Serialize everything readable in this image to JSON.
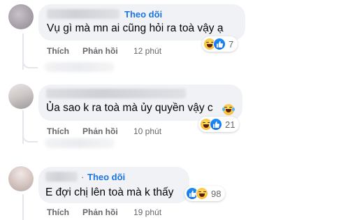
{
  "comments": [
    {
      "follow_label": "Theo dõi",
      "text": "Vụ gì mà mn ai cũng hỏi ra toà vậy ạ",
      "like_label": "Thích",
      "reply_label": "Phản hồi",
      "time": "12 phút",
      "reaction_count": "7",
      "reaction_icons": [
        "haha-icon",
        "like-icon"
      ]
    },
    {
      "follow_label": "",
      "text": "Ủa sao k ra toà mà ủy quyền vậy c",
      "like_label": "Thích",
      "reply_label": "Phản hồi",
      "time": "10 phút",
      "reaction_count": "21",
      "reaction_icons": [
        "haha-icon",
        "like-icon"
      ]
    },
    {
      "dot": "·",
      "follow_label": "Theo dõi",
      "text": "E đợi chị lên toà mà k thấy",
      "like_label": "Thích",
      "reply_label": "Phản hồi",
      "time": "19 phút",
      "reaction_count": "98",
      "reaction_icons": [
        "like-icon",
        "haha-icon"
      ]
    }
  ],
  "colors": {
    "bubble": "#f0f2f5",
    "follow": "#1b74e4",
    "meta": "#65676b",
    "like": "#1877f2",
    "haha": "#f7b125"
  }
}
